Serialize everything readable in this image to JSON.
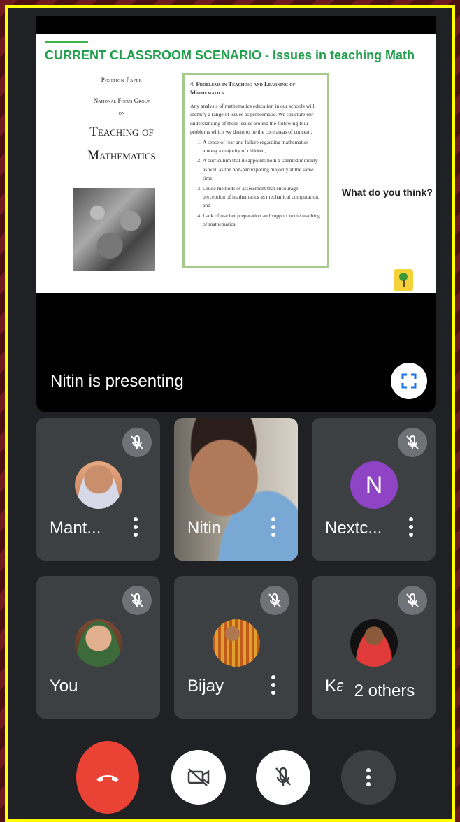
{
  "presentation": {
    "slide_title": "CURRENT CLASSROOM SCENARIO - Issues in teaching Math",
    "cover": {
      "position_paper": "Position Paper",
      "focus_group": "National Focus Group",
      "on": "on",
      "title_line1": "Teaching of",
      "title_line2": "Mathematics"
    },
    "textbox": {
      "heading": "4. Problems in Teaching and Learning of Mathematics",
      "body": "Any analysis of mathematics education in our schools will identify a range of issues as problematic. We structure our understanding of these issues around the following four problems which we deem to be the core areas of concern:",
      "items": [
        "A sense of fear and failure regarding mathematics among a majority of children,",
        "A curriculum that disappoints both a talented minority as well as the non-participating majority at the same time,",
        "Crude methods of assessment that encourage perception of mathematics as mechanical computation, and",
        "Lack of teacher preparation and support in the teaching of mathematics."
      ]
    },
    "question": "What do you think?",
    "presenting_label": "Nitin is presenting"
  },
  "participants": [
    {
      "name": "Mant...",
      "muted": true,
      "avatar": "photo"
    },
    {
      "name": "Nitin",
      "muted": false,
      "avatar": "video"
    },
    {
      "name": "Nextc...",
      "muted": true,
      "avatar": "letter",
      "letter": "N"
    },
    {
      "name": "You",
      "muted": true,
      "avatar": "photo"
    },
    {
      "name": "Bijay",
      "muted": true,
      "avatar": "photo"
    },
    {
      "name": "Kamal",
      "muted": true,
      "avatar": "photo"
    }
  ],
  "others_badge": "2 others",
  "colors": {
    "end_call": "#ea4335",
    "tile_bg": "#3c4043",
    "frame_border": "#ffff00",
    "letter_avatar": "#8e44c5"
  }
}
